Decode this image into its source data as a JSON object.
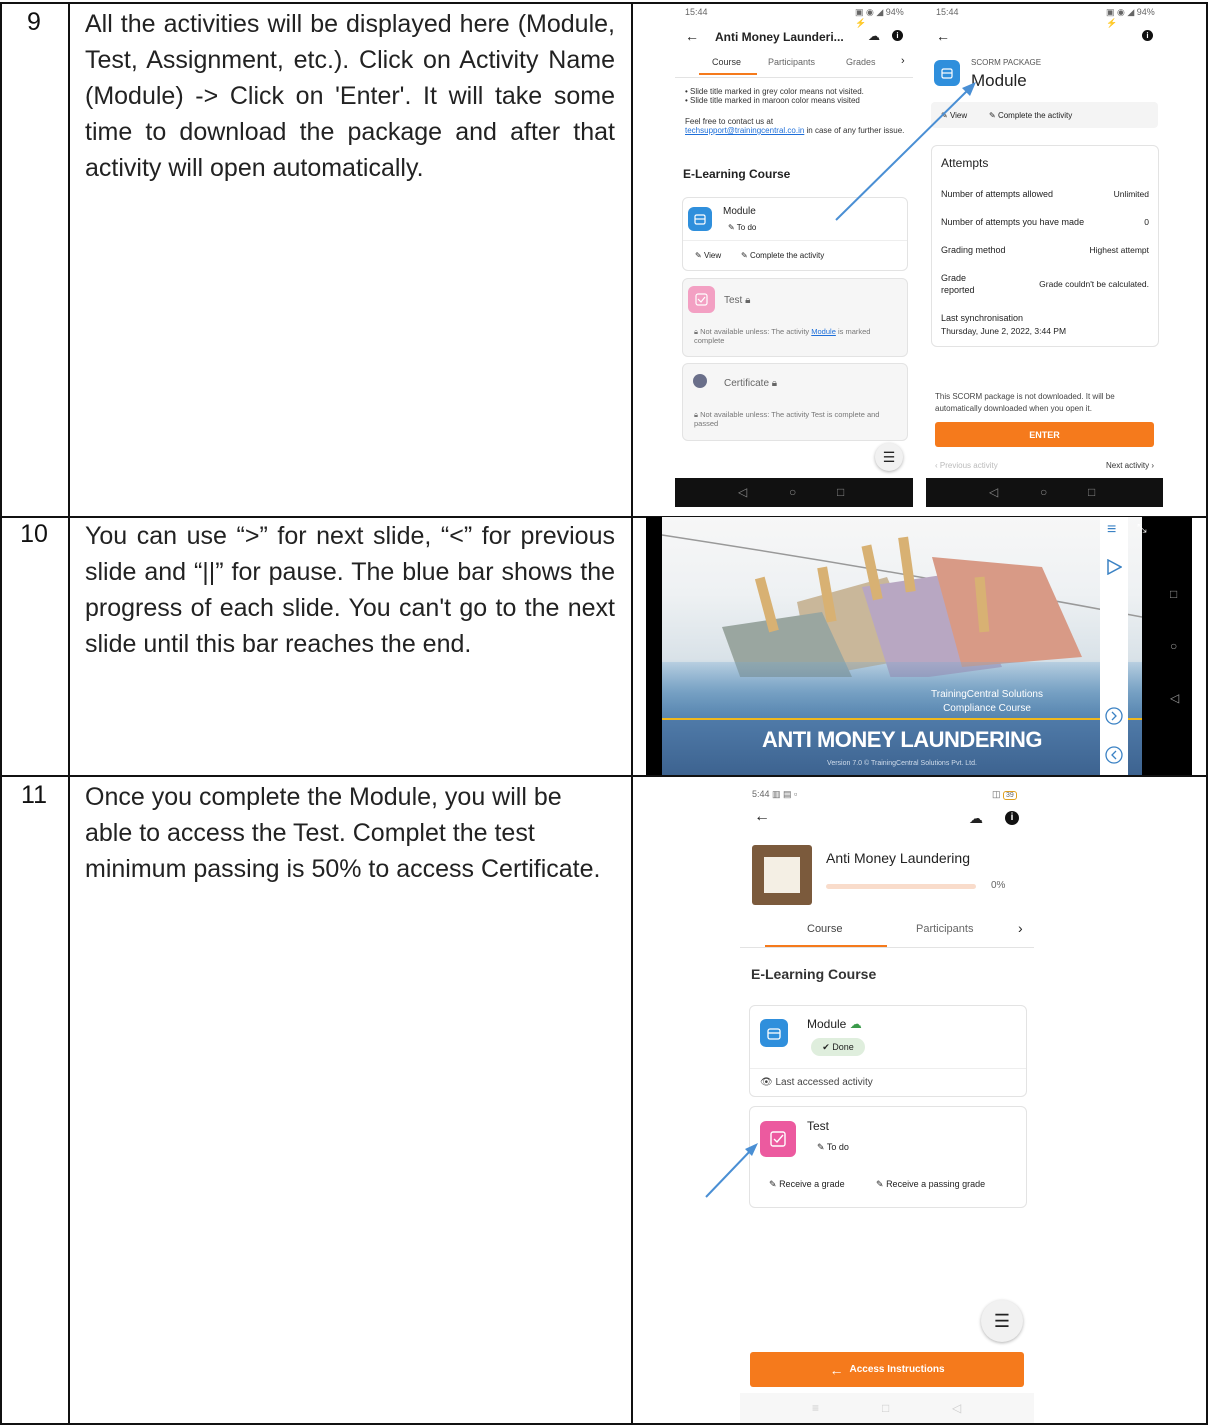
{
  "rows": [
    {
      "number": "9",
      "text": "All the activities will be displayed here (Module, Test, Assignment, etc.). Click on Activity Name (Module) -> Click on 'Enter'. It will take some time to download the package and after that activity will open automatically."
    },
    {
      "number": "10",
      "text": "You can use “>” for next slide, “<” for previous slide and “||” for pause. The blue bar shows the progress of each slide. You can't go to the next slide until this bar reaches the end."
    },
    {
      "number": "11",
      "text": "Once you complete the Module, you will be able to access the Test. Complet the test minimum passing is 50% to access Certificate."
    }
  ],
  "screen_a": {
    "time": "15:44",
    "status": "94%",
    "title": "Anti Money Launderi...",
    "tabs": [
      "Course",
      "Participants",
      "Grades"
    ],
    "bullets": [
      "Slide title marked in grey color means not visited.",
      "Slide title marked in maroon color means visited"
    ],
    "contact_prefix": "Feel free to contact us at",
    "contact_email": "techsupport@trainingcentral.co.in",
    "contact_suffix": "in case of any further issue.",
    "section": "E-Learning Course",
    "module_name": "Module",
    "module_status": "To do",
    "view_label": "View",
    "complete_label": "Complete the activity",
    "test_name": "Test",
    "test_restriction_prefix": "Not available unless: The activity",
    "test_restriction_link": "Module",
    "test_restriction_suffix": "is marked complete",
    "cert_name": "Certificate",
    "cert_restriction": "Not available unless: The activity Test is complete and passed"
  },
  "screen_b": {
    "time": "15:44",
    "status": "94%",
    "package_label": "SCORM PACKAGE",
    "title": "Module",
    "view_label": "View",
    "complete_label": "Complete the activity",
    "attempts_heading": "Attempts",
    "rows": [
      {
        "label": "Number of attempts allowed",
        "value": "Unlimited"
      },
      {
        "label": "Number of attempts you have made",
        "value": "0"
      },
      {
        "label": "Grading method",
        "value": "Highest attempt"
      },
      {
        "label": "Grade reported",
        "value": "Grade couldn't be calculated."
      }
    ],
    "sync_label": "Last synchronisation",
    "sync_value": "Thursday, June 2, 2022, 3:44 PM",
    "notice": "This SCORM package is not downloaded. It will be automatically downloaded when you open it.",
    "enter_label": "ENTER",
    "prev_label": "Previous activity",
    "next_label": "Next activity"
  },
  "slide": {
    "company": "TrainingCentral Solutions",
    "course": "Compliance Course",
    "title": "ANTI MONEY LAUNDERING",
    "version": "Version 7.0 © TrainingCentral Solutions Pvt. Ltd."
  },
  "screen_c": {
    "time": "5:44",
    "battery": "39",
    "course_title": "Anti Money Laundering",
    "progress_label": "0%",
    "progress_value": 0,
    "tabs": [
      "Course",
      "Participants"
    ],
    "section": "E-Learning Course",
    "module_name": "Module",
    "module_status": "Done",
    "last_accessed": "Last accessed activity",
    "test_name": "Test",
    "test_status": "To do",
    "cond1": "Receive a grade",
    "cond2": "Receive a passing grade",
    "access_label": "Access Instructions"
  },
  "colors": {
    "accent_orange": "#f57a1c",
    "module_blue": "#2f8fdc",
    "test_pink": "#ec5a9f",
    "done_green": "#dfeedd",
    "arrow_blue": "#4a8fd4"
  }
}
